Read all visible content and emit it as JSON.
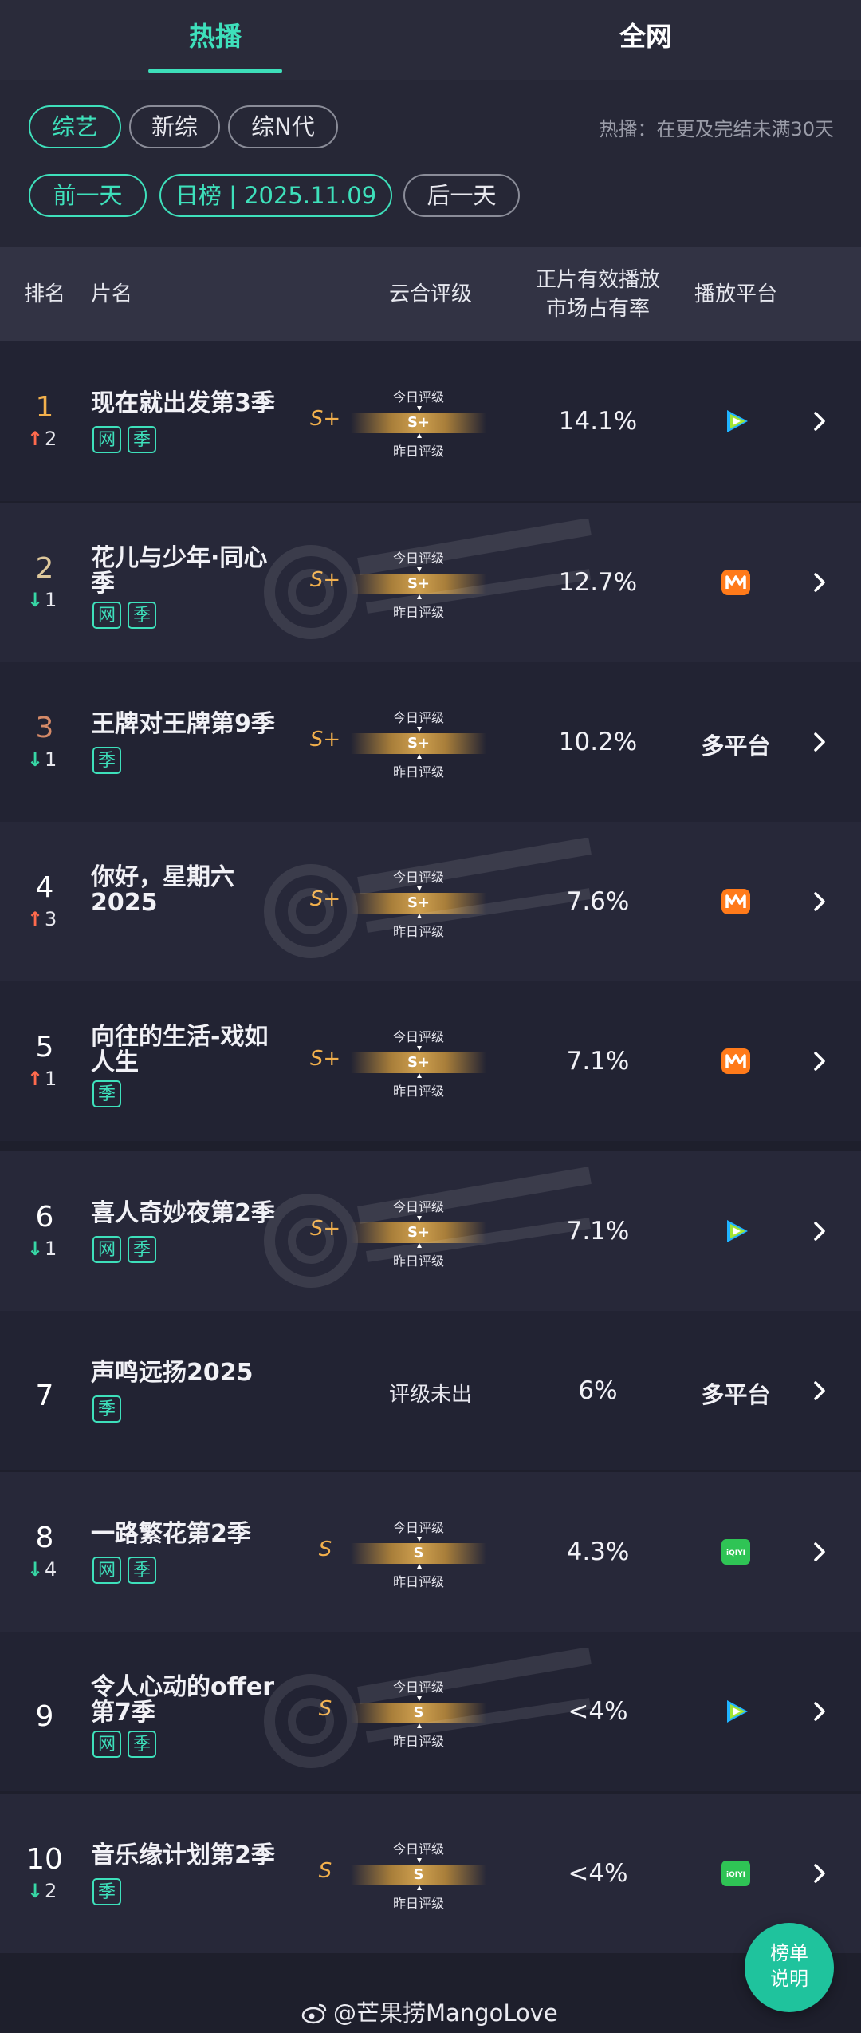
{
  "tabs": [
    "热播",
    "全网"
  ],
  "filters": {
    "categories": [
      "综艺",
      "新综",
      "综N代"
    ],
    "note": "热播：在更及完结未满30天",
    "prev_day": "前一天",
    "date_label": "日榜 | 2025.11.09",
    "next_day": "后一天"
  },
  "table_headers": {
    "rank": "排名",
    "title": "片名",
    "grade": "云合评级",
    "share_line1": "正片有效播放",
    "share_line2": "市场占有率",
    "platform": "播放平台"
  },
  "grade_labels": {
    "today": "今日评级",
    "yesterday": "昨日评级"
  },
  "rows": [
    {
      "rank": "1",
      "delta": "2",
      "dir": "up",
      "title": "现在就出发第3季",
      "tags": [
        "网",
        "季"
      ],
      "grade_letter": "S+",
      "grade": "S+",
      "share": "14.1%",
      "platform": "tencent-video"
    },
    {
      "rank": "2",
      "delta": "1",
      "dir": "down",
      "title": "花儿与少年·同心季",
      "tags": [
        "网",
        "季"
      ],
      "grade_letter": "S+",
      "grade": "S+",
      "share": "12.7%",
      "platform": "mango-tv"
    },
    {
      "rank": "3",
      "delta": "1",
      "dir": "down",
      "title": "王牌对王牌第9季",
      "tags": [
        "季"
      ],
      "grade_letter": "S+",
      "grade": "S+",
      "share": "10.2%",
      "platform": "multi",
      "platform_text": "多平台"
    },
    {
      "rank": "4",
      "delta": "3",
      "dir": "up",
      "title": "你好，星期六2025",
      "tags": [],
      "grade_letter": "S+",
      "grade": "S+",
      "share": "7.6%",
      "platform": "mango-tv"
    },
    {
      "rank": "5",
      "delta": "1",
      "dir": "up",
      "title": "向往的生活-戏如人生",
      "tags": [
        "季"
      ],
      "grade_letter": "S+",
      "grade": "S+",
      "share": "7.1%",
      "platform": "mango-tv"
    },
    {
      "rank": "6",
      "delta": "1",
      "dir": "down",
      "title": "喜人奇妙夜第2季",
      "tags": [
        "网",
        "季"
      ],
      "grade_letter": "S+",
      "grade": "S+",
      "share": "7.1%",
      "platform": "tencent-video"
    },
    {
      "rank": "7",
      "delta": "",
      "dir": "",
      "title": "声鸣远扬2025",
      "tags": [
        "季"
      ],
      "grade_letter": "",
      "grade": "",
      "no_grade": "评级未出",
      "share": "6%",
      "platform": "multi",
      "platform_text": "多平台"
    },
    {
      "rank": "8",
      "delta": "4",
      "dir": "down",
      "title": "一路繁花第2季",
      "tags": [
        "网",
        "季"
      ],
      "grade_letter": "S",
      "grade": "S",
      "share": "4.3%",
      "platform": "iqiyi"
    },
    {
      "rank": "9",
      "delta": "",
      "dir": "",
      "title": "令人心动的offer第7季",
      "tags": [
        "网",
        "季"
      ],
      "grade_letter": "S",
      "grade": "S",
      "share": "<4%",
      "platform": "tencent-video"
    },
    {
      "rank": "10",
      "delta": "2",
      "dir": "down",
      "title": "音乐缘计划第2季",
      "tags": [
        "季"
      ],
      "grade_letter": "S",
      "grade": "S",
      "share": "<4%",
      "platform": "iqiyi"
    }
  ],
  "platform_icon_text": {
    "iqiyi": "iQIYI"
  },
  "fab": {
    "line1": "榜单",
    "line2": "说明"
  },
  "weibo_credit": "@芒果捞MangoLove",
  "colors": {
    "accent": "#3ee0bb",
    "gold": "#f2b04c",
    "up": "#ff6a4d",
    "down": "#37d6a5"
  }
}
